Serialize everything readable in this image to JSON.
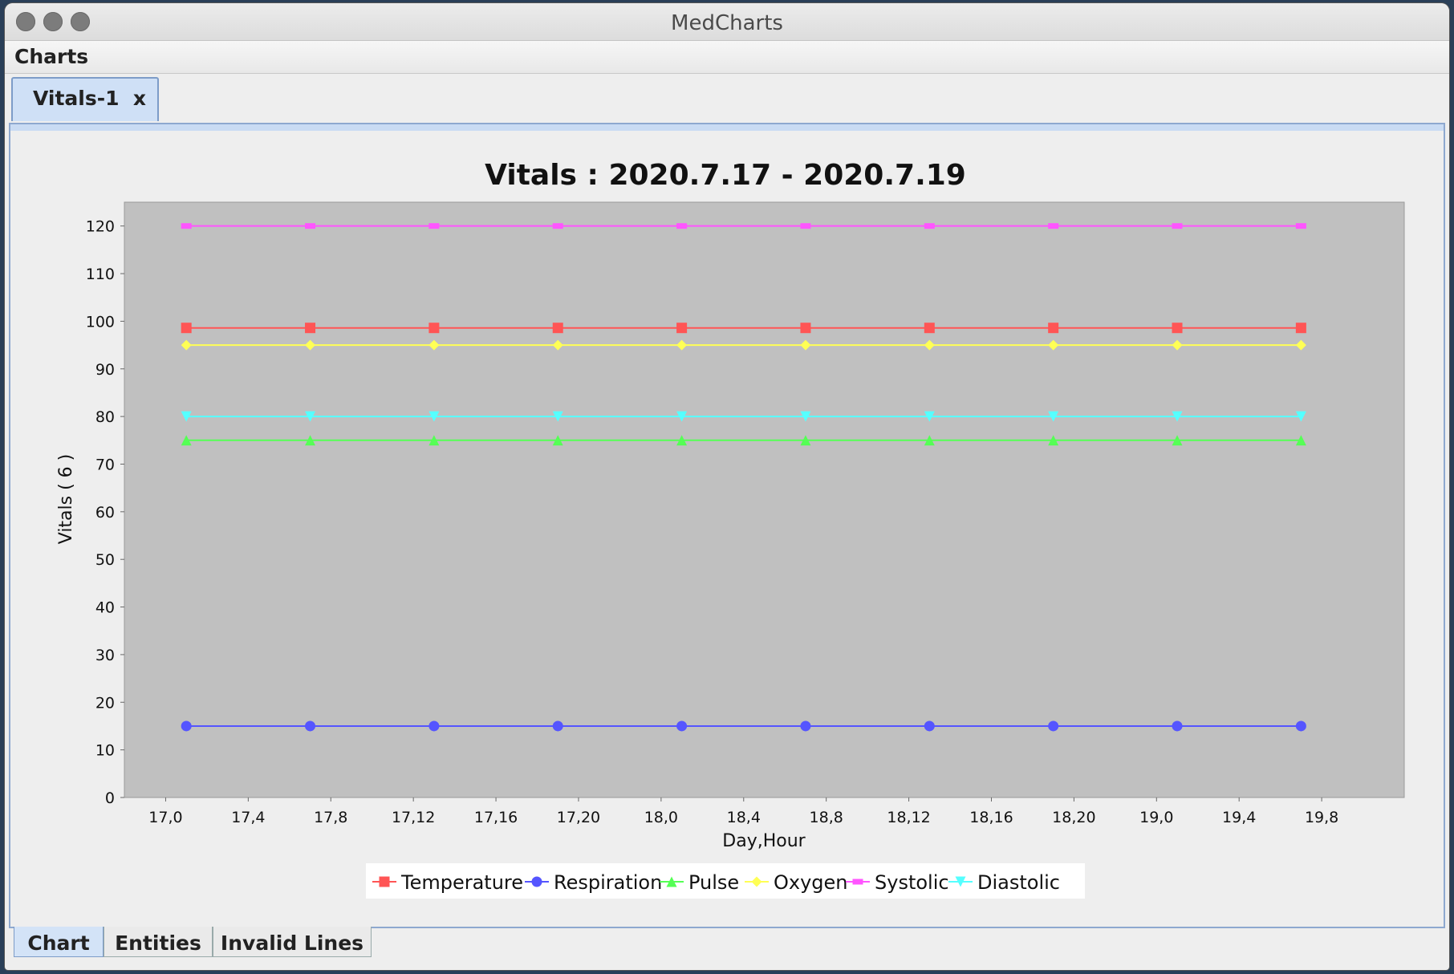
{
  "window": {
    "title": "MedCharts"
  },
  "menu": {
    "charts_label": "Charts"
  },
  "doc_tab": {
    "label": "Vitals-1  x"
  },
  "bottom_tabs": [
    "Chart",
    "Entities",
    "Invalid Lines"
  ],
  "chart_data": {
    "type": "line",
    "title": "Vitals : 2020.7.17 - 2020.7.19",
    "xlabel": "Day,Hour",
    "ylabel": "Vitals ( 6 )",
    "ylim": [
      0,
      125
    ],
    "yticks": [
      0,
      10,
      20,
      30,
      40,
      50,
      60,
      70,
      80,
      90,
      100,
      110,
      120
    ],
    "xtick_labels": [
      "17,0",
      "17,4",
      "17,8",
      "17,12",
      "17,16",
      "17,20",
      "18,0",
      "18,4",
      "18,8",
      "18,12",
      "18,16",
      "18,20",
      "19,0",
      "19,4",
      "19,8"
    ],
    "grid": false,
    "plot_background": "#c0c0c0",
    "legend_position": "bottom",
    "series": [
      {
        "name": "Temperature",
        "color": "#ff5555",
        "marker": "square",
        "values": [
          98.6,
          98.6,
          98.6,
          98.6,
          98.6,
          98.6,
          98.6,
          98.6,
          98.6,
          98.6
        ]
      },
      {
        "name": "Respiration",
        "color": "#5555ff",
        "marker": "circle",
        "values": [
          15,
          15,
          15,
          15,
          15,
          15,
          15,
          15,
          15,
          15
        ]
      },
      {
        "name": "Pulse",
        "color": "#55ff55",
        "marker": "triangle-up",
        "values": [
          75,
          75,
          75,
          75,
          75,
          75,
          75,
          75,
          75,
          75
        ]
      },
      {
        "name": "Oxygen",
        "color": "#ffff55",
        "marker": "diamond",
        "values": [
          95,
          95,
          95,
          95,
          95,
          95,
          95,
          95,
          95,
          95
        ]
      },
      {
        "name": "Systolic",
        "color": "#ff55ff",
        "marker": "rect",
        "values": [
          120,
          120,
          120,
          120,
          120,
          120,
          120,
          120,
          120,
          120
        ]
      },
      {
        "name": "Diastolic",
        "color": "#55ffff",
        "marker": "triangle-down",
        "values": [
          80,
          80,
          80,
          80,
          80,
          80,
          80,
          80,
          80,
          80
        ]
      }
    ],
    "x_values": [
      1.1,
      1.7,
      2.3,
      2.9,
      3.5,
      4.1,
      4.7,
      5.3,
      5.9,
      6.5
    ],
    "xlim": [
      0.8,
      7.0
    ],
    "xtick_values": [
      1.0,
      1.4,
      1.8,
      2.2,
      2.6,
      3.0,
      3.4,
      3.8,
      4.2,
      4.6,
      5.0,
      5.4,
      5.8,
      6.2,
      6.6
    ]
  }
}
